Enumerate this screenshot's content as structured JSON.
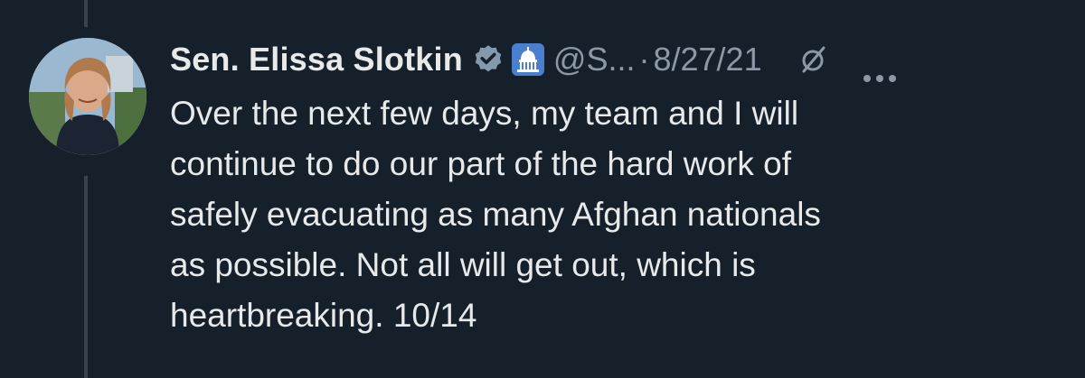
{
  "tweet": {
    "display_name": "Sen. Elissa Slotkin",
    "handle": "@S...",
    "separator": "·",
    "timestamp": "8/27/21",
    "text": "Over the next few days, my team and I will\ncontinue to do our part of the hard work of\nsafely evacuating as many Afghan nationals\nas possible. Not all will get out, which is\nheartbreaking. 10/14"
  },
  "icons": {
    "verified": "verified-badge-icon",
    "affiliation": "capitol-dome-icon",
    "grok": "slashed-circle-icon",
    "more": "more-options-icon"
  },
  "colors": {
    "background": "#15202b",
    "primary_text": "#e7e9ea",
    "secondary_text": "#8b98a5",
    "verified_badge": "#829aab",
    "affiliation_badge": "#4a7fd0"
  }
}
